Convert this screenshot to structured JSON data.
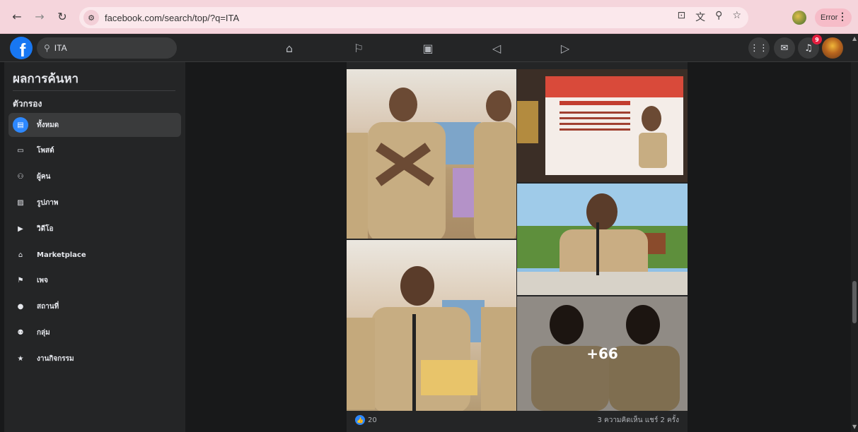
{
  "browser": {
    "url": "facebook.com/search/top/?q=ITA",
    "error_label": "Error"
  },
  "topbar": {
    "search_value": "ITA",
    "notifications_count": "9"
  },
  "sidebar": {
    "title": "ผลการค้นหา",
    "filters_heading": "ตัวกรอง",
    "items": [
      {
        "label": "ทั้งหมด",
        "icon": "feed-icon",
        "active": true
      },
      {
        "label": "โพสต์",
        "icon": "post-icon",
        "active": false
      },
      {
        "label": "ผู้คน",
        "icon": "people-icon",
        "active": false
      },
      {
        "label": "รูปภาพ",
        "icon": "photo-icon",
        "active": false
      },
      {
        "label": "วิดีโอ",
        "icon": "video-icon",
        "active": false
      },
      {
        "label": "Marketplace",
        "icon": "marketplace-icon",
        "active": false
      },
      {
        "label": "เพจ",
        "icon": "flag-icon",
        "active": false
      },
      {
        "label": "สถานที่",
        "icon": "location-icon",
        "active": false
      },
      {
        "label": "กลุ่ม",
        "icon": "groups-icon",
        "active": false
      },
      {
        "label": "งานกิจกรรม",
        "icon": "events-icon",
        "active": false
      }
    ]
  },
  "post": {
    "more_photos": "+66",
    "likes": "20",
    "comments_shares": "3 ความคิดเห็น  แชร์ 2 ครั้ง"
  }
}
